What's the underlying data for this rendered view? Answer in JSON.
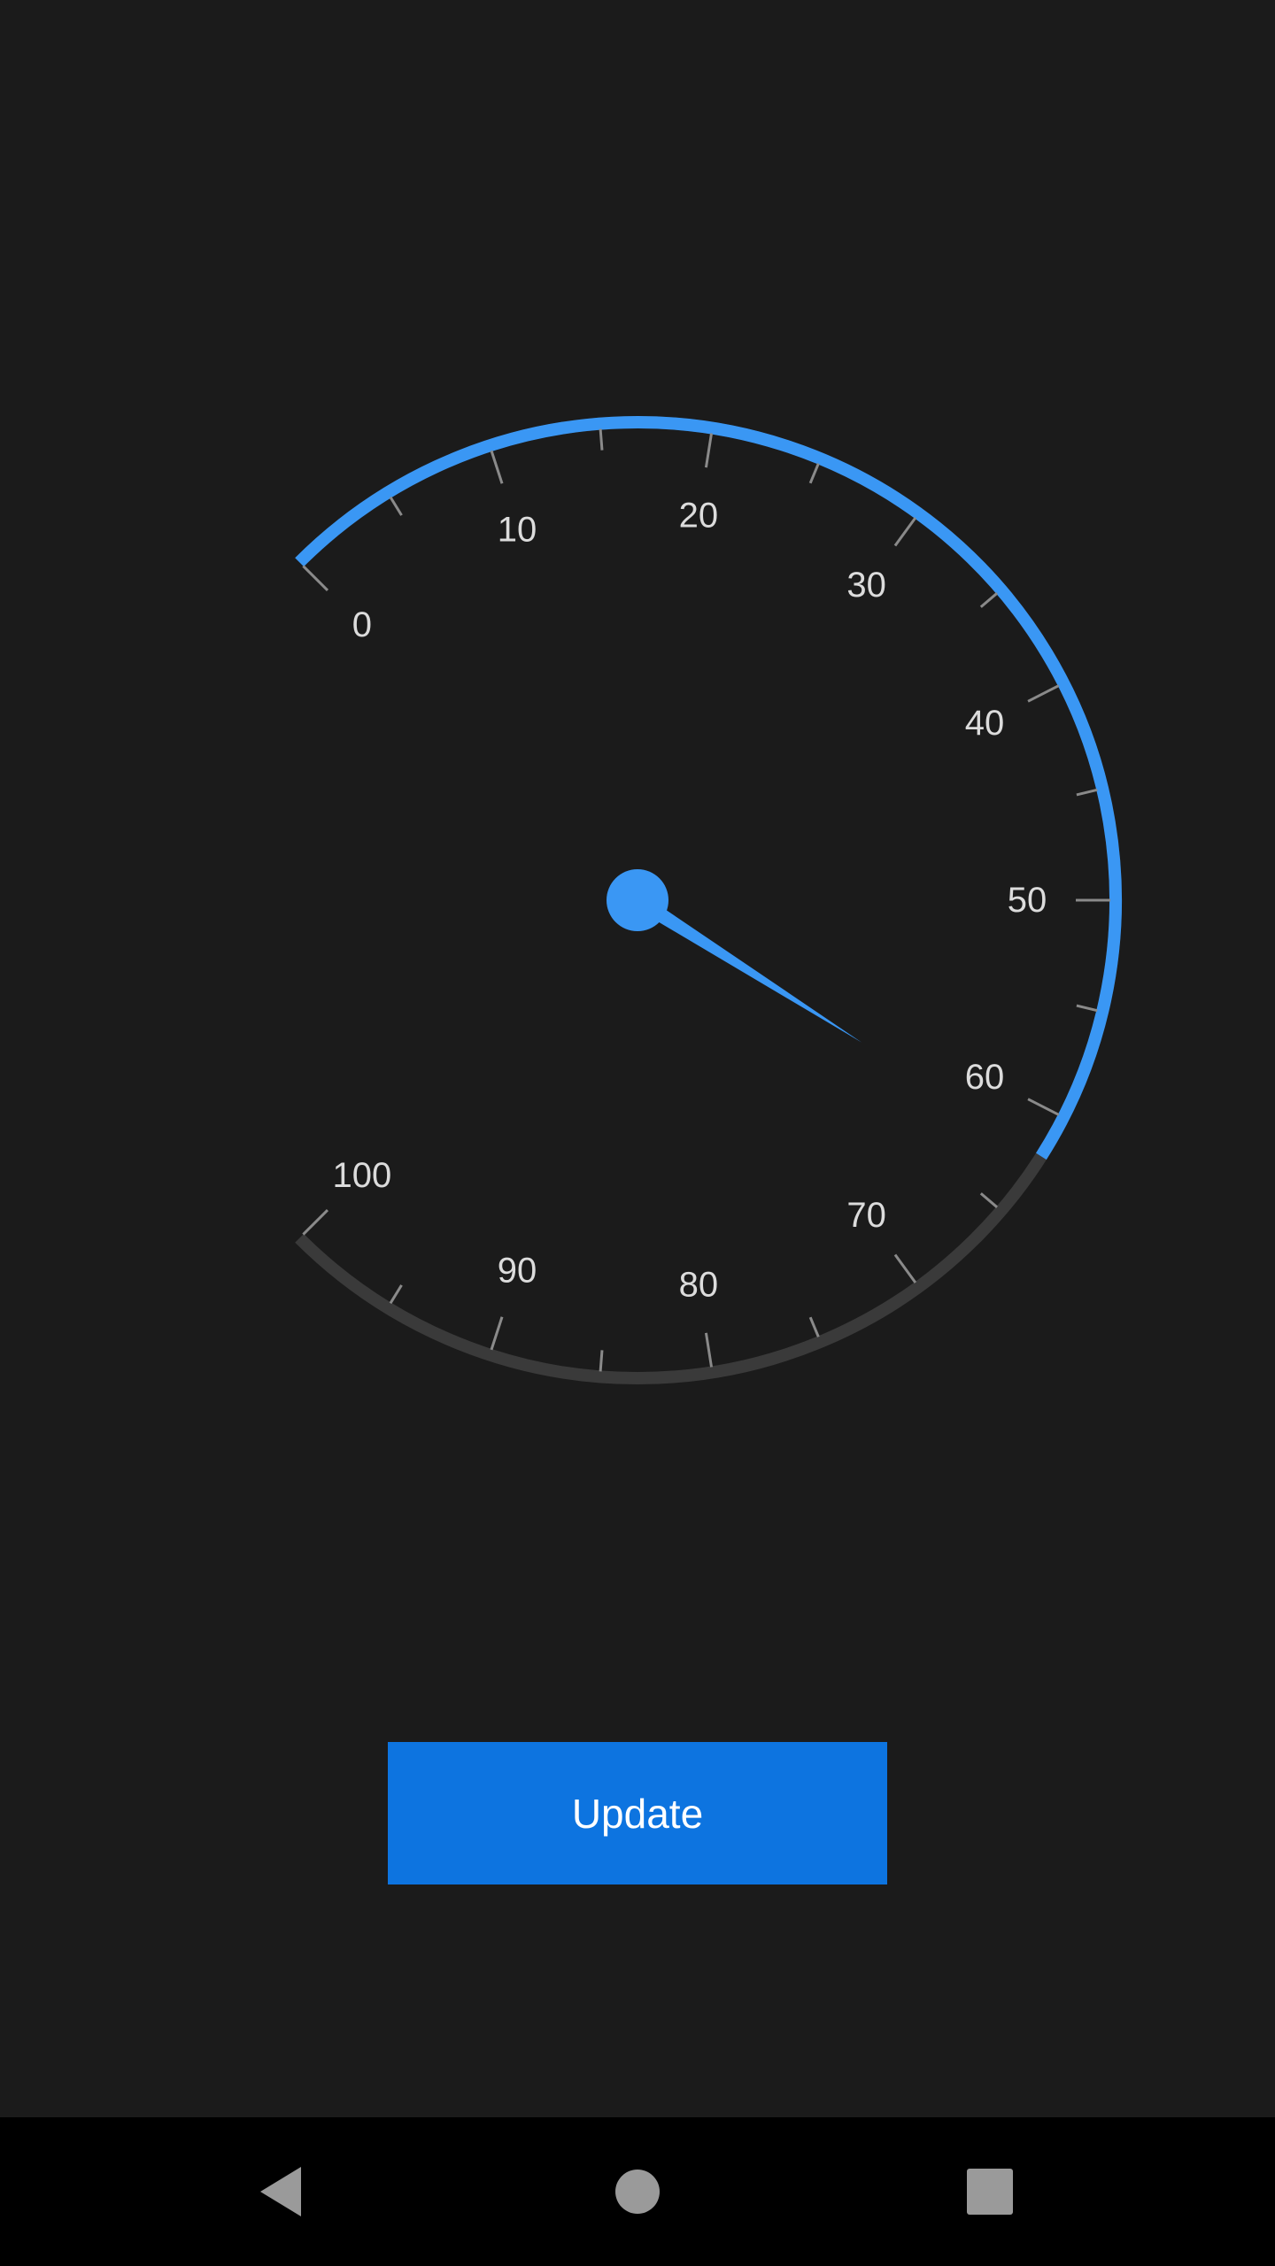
{
  "gauge": {
    "value": 62,
    "min": 0,
    "max": 100,
    "labels": [
      "0",
      "10",
      "20",
      "30",
      "40",
      "50",
      "60",
      "70",
      "80",
      "90",
      "100"
    ],
    "colors": {
      "accent": "#3a97f4",
      "track": "#3a3a3a",
      "tick": "#8a8a8a",
      "label": "#dcdcdc"
    }
  },
  "update_button": {
    "label": "Update",
    "color": "#0d74e0"
  },
  "navbar": {
    "back_icon": "back-triangle-icon",
    "home_icon": "home-circle-icon",
    "recents_icon": "recents-square-icon",
    "icon_color": "#9a9a9a"
  }
}
